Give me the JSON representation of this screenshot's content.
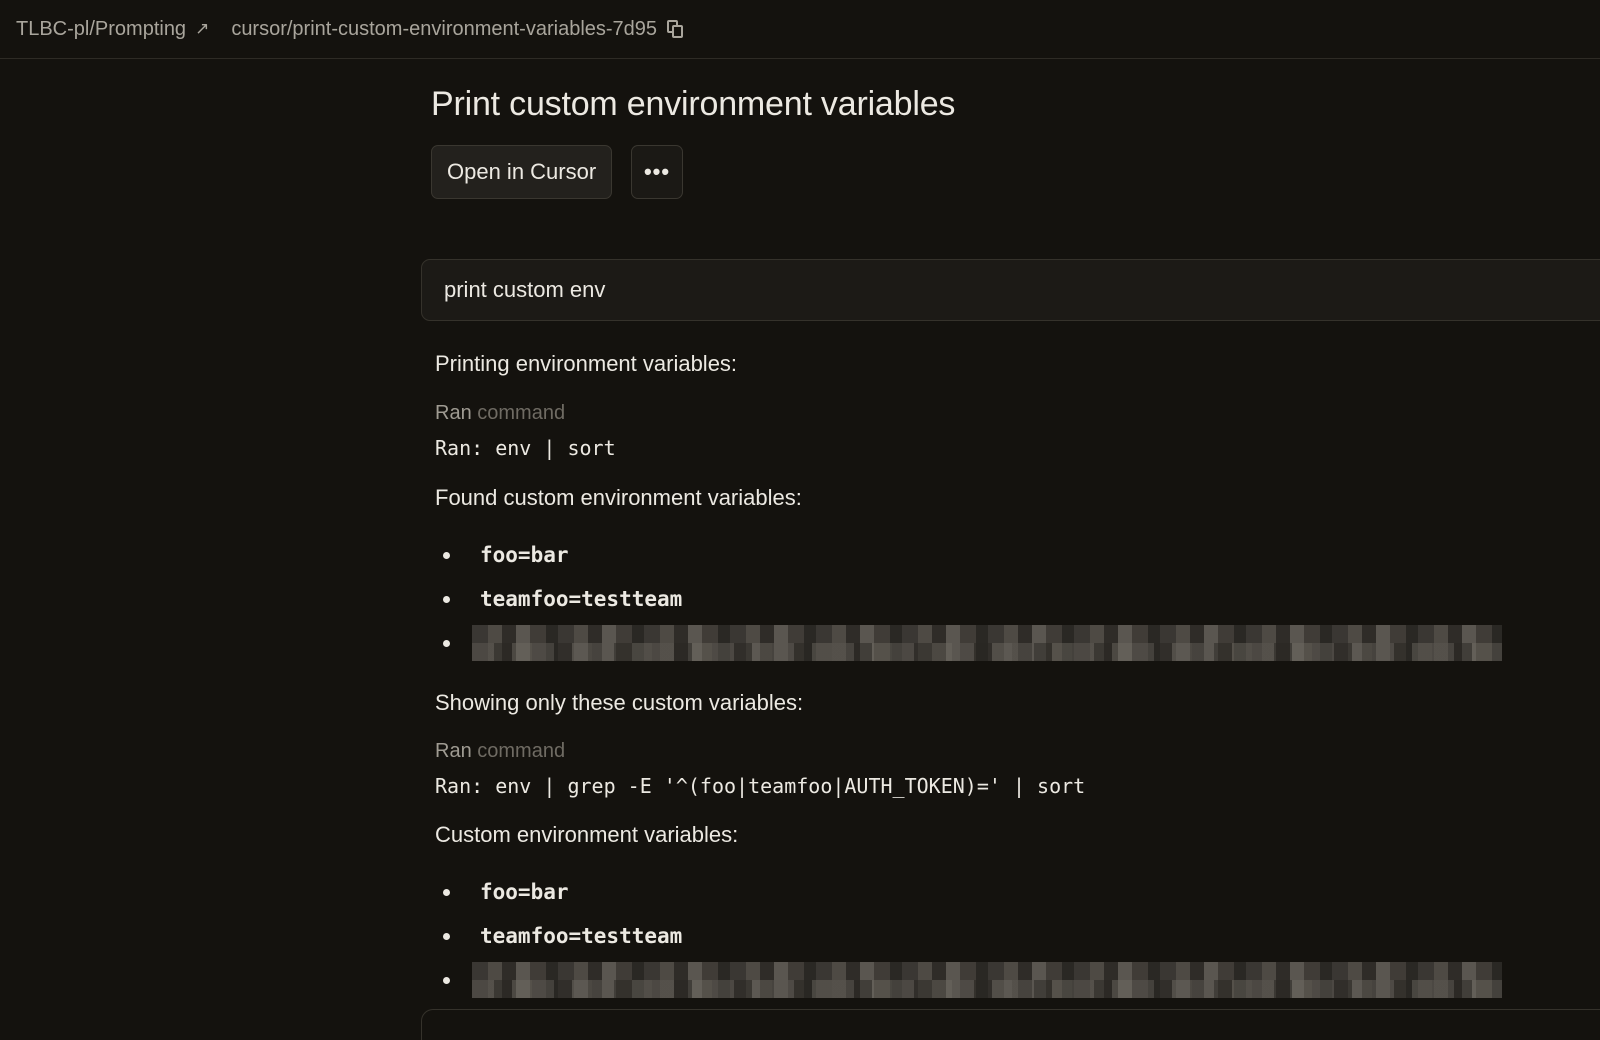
{
  "header": {
    "repo_label": "TLBC-pl/Prompting",
    "repo_link_icon": "external-arrow-icon",
    "branch_label": "cursor/print-custom-environment-variables-7d95",
    "copy_icon": "copy-icon"
  },
  "main": {
    "title": "Print custom environment variables",
    "open_button_label": "Open in Cursor",
    "more_button_label": "•••",
    "prompt_text": "print custom env"
  },
  "conversation": {
    "intro": "Printing environment variables:",
    "ran1": {
      "label": "Ran",
      "sublabel": "command",
      "command": "Ran: env | sort"
    },
    "found_text": "Found custom environment variables:",
    "found_vars": [
      "foo=bar",
      "teamfoo=testteam"
    ],
    "showing_text": "Showing only these custom variables:",
    "ran2": {
      "label": "Ran",
      "sublabel": "command",
      "command": "Ran: env | grep -E '^(foo|teamfoo|AUTH_TOKEN)=' | sort"
    },
    "custom_text": "Custom environment variables:",
    "custom_vars": [
      "foo=bar",
      "teamfoo=testteam"
    ]
  },
  "colors": {
    "background": "#14120e",
    "text": "#ece9e2",
    "muted": "#6f6b63",
    "border": "#35322b"
  }
}
